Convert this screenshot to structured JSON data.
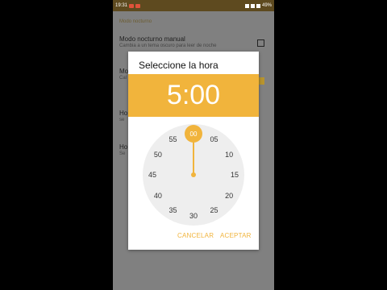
{
  "status": {
    "time": "19:31",
    "battery": "49%"
  },
  "background": {
    "section_header": "Modo nocturno",
    "items": [
      {
        "title": "Modo nocturno manual",
        "subtitle": "Cambia a un tema oscuro para leer de noche"
      },
      {
        "title": "Mo",
        "subtitle": "Cal"
      },
      {
        "title": "Ho",
        "subtitle": "se"
      },
      {
        "title": "Ho",
        "subtitle": "Se"
      }
    ]
  },
  "dialog": {
    "title": "Seleccione la hora",
    "time_hour": "5",
    "time_sep": ":",
    "time_min": "00",
    "clock": {
      "selected": "00",
      "numbers": [
        "05",
        "10",
        "15",
        "20",
        "25",
        "30",
        "35",
        "40",
        "45",
        "50",
        "55"
      ]
    },
    "cancel_label": "CANCELAR",
    "accept_label": "ACEPTAR"
  },
  "colors": {
    "accent": "#f1b43c"
  }
}
